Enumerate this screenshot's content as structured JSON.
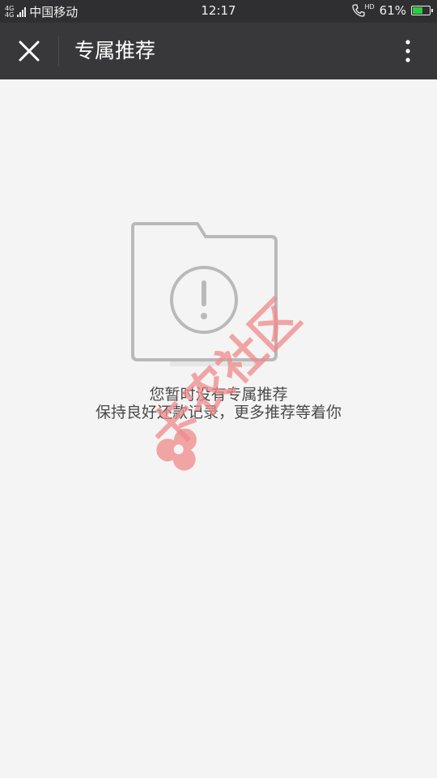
{
  "status_bar": {
    "network_label_top": "4G",
    "network_label_sub": "4G",
    "carrier": "中国移动",
    "time": "12:17",
    "hd_label": "HD",
    "battery_percent": "61%",
    "battery_level": 0.61,
    "battery_color": "#2ecc40"
  },
  "header": {
    "title": "专属推荐"
  },
  "empty_state": {
    "line1": "您暂时没有专属推荐",
    "line2": "保持良好还款记录，更多推荐等着你"
  },
  "watermark": {
    "text": "卡农社区",
    "color": "#f08a8a"
  }
}
